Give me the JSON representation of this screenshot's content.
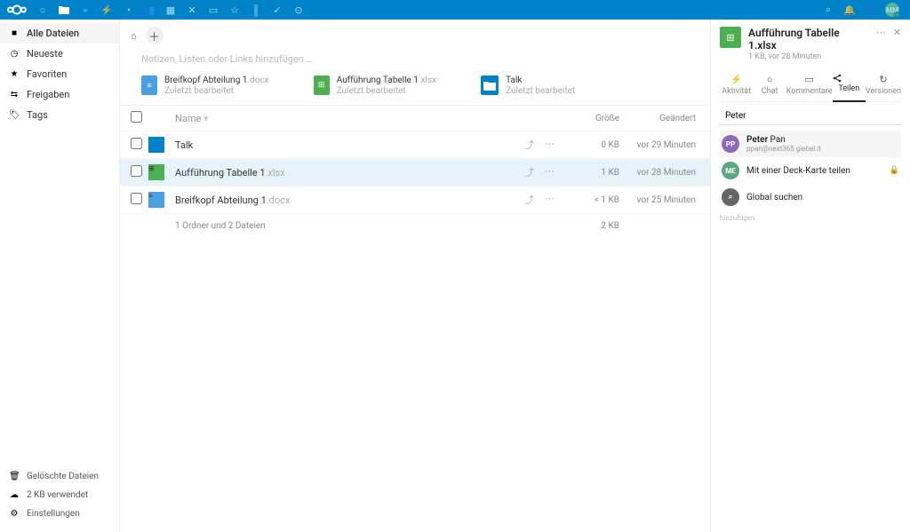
{
  "topbar": {
    "avatar_initials": "MM"
  },
  "sidebar": {
    "items": [
      {
        "icon": "folder",
        "label": "Alle Dateien"
      },
      {
        "icon": "clock",
        "label": "Neueste"
      },
      {
        "icon": "star",
        "label": "Favoriten"
      },
      {
        "icon": "share",
        "label": "Freigaben"
      },
      {
        "icon": "tag",
        "label": "Tags"
      }
    ],
    "footer": [
      {
        "icon": "trash",
        "label": "Gelöschte Dateien"
      },
      {
        "icon": "cloud",
        "label": "2 KB verwendet"
      },
      {
        "icon": "gear",
        "label": "Einstellungen"
      }
    ]
  },
  "notes_placeholder": "Notizen, Listen oder Links hinzufügen …",
  "recent": [
    {
      "type": "doc",
      "name": "Breifkopf Abteilung 1",
      "ext": ".docx",
      "sub": "Zuletzt bearbeitet"
    },
    {
      "type": "xls",
      "name": "Aufführung Tabelle 1",
      "ext": ".xlsx",
      "sub": "Zuletzt bearbeitet"
    },
    {
      "type": "fold",
      "name": "Talk",
      "ext": "",
      "sub": "Zuletzt bearbeitet"
    }
  ],
  "table": {
    "headers": {
      "name": "Name",
      "size": "Größe",
      "modified": "Geändert"
    },
    "rows": [
      {
        "type": "fold",
        "name": "Talk",
        "ext": "",
        "size": "0 KB",
        "modified": "vor 29 Minuten",
        "selected": false
      },
      {
        "type": "xls",
        "name": "Aufführung Tabelle 1",
        "ext": ".xlsx",
        "size": "1 KB",
        "modified": "vor 28 Minuten",
        "selected": true
      },
      {
        "type": "doc",
        "name": "Breifkopf Abteilung 1",
        "ext": ".docx",
        "size": "< 1 KB",
        "modified": "vor 25 Minuten",
        "selected": false
      }
    ],
    "summary": {
      "text": "1 Ordner und 2 Dateien",
      "size": "2 KB"
    }
  },
  "details": {
    "filename": "Aufführung Tabelle 1.xlsx",
    "subtitle": "1 KB, vor 28 Minuten",
    "tabs": [
      {
        "icon": "⚡",
        "label": "Aktivität"
      },
      {
        "icon": "💬",
        "label": "Chat"
      },
      {
        "icon": "🗨",
        "label": "Kommentare"
      },
      {
        "icon": "share",
        "label": "Teilen"
      },
      {
        "icon": "↻",
        "label": "Versionen"
      }
    ],
    "search_value": "Peter",
    "results": [
      {
        "avatar": "PP",
        "avatar_class": "pp",
        "name_bold": "Peter",
        "name_rest": " Pan",
        "sub": "ppan@next365.giebel.it",
        "hl": true
      },
      {
        "avatar": "ME",
        "avatar_class": "deck",
        "name_bold": "",
        "name_rest": "Mit einer Deck-Karte teilen",
        "sub": "",
        "lock": true
      },
      {
        "avatar": "🔍",
        "avatar_class": "glob",
        "name_bold": "",
        "name_rest": "Global suchen",
        "sub": ""
      }
    ],
    "hint": "hinzufügen"
  }
}
